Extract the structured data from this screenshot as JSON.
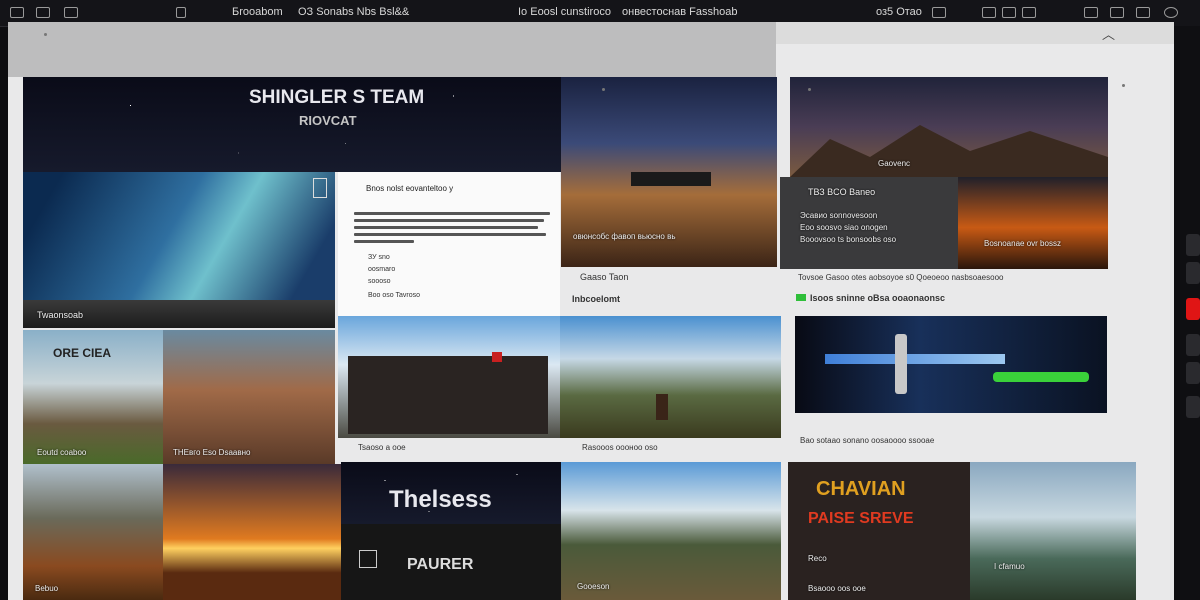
{
  "topbar": {
    "items": [
      "Бrooabom",
      "ОЗ Sonabs Nbs Bsl&&",
      "Io Eoosl cunstiroco",
      "онвестоснав Fasshoab",
      "оз5 Отао"
    ],
    "accent": "#141418"
  },
  "tiles": {
    "team_title": "SHINGLER S TEAM",
    "team_subtitle": "RIOVCAT",
    "aurora_caption": "Twaonsoab",
    "text_card_heading": "Bnos nolst eovanteltoo y",
    "text_card_bullets": [
      "ЗУ sno",
      "oosmaro",
      "soooso"
    ],
    "text_card_footer": "Boo oso Tavroso",
    "space_platform_caption": "овюнсобс фавоп вьюсно вь",
    "under_space_caption": "Gaaso Taon",
    "side_heading": "Inbcoelomt",
    "mountain_peak_caption": "Gaovenc",
    "dark_panel_heading": "ТВЗ BCO Baneo",
    "dark_panel_lines": [
      "Эсавио sonnovesoon",
      "Eoo soosvo siao onogen",
      "Booovsoo ts bonsoobs oso"
    ],
    "sunset_caption": "Bosnoanae ovr bossz",
    "long_caption": "Tovsoe Gasoo otes aobsoyoe s0 Qoeoeoo nasbsoaesooo",
    "green_heading": "Isoos sninne oBsa ooaonaonsc",
    "gadget_caption": "Bao sotaao sonano oosaoooo ssooae",
    "mountain_left_title": "ORE CIEA",
    "mountain_left_caption": "Eoutd coaboo",
    "mountain_right_caption": "ТНЕвго Eso Dsaавно",
    "city_caption": "Tsaoso a ooe",
    "landscape_caption": "Rasooos оооноо oso",
    "thebess_title": "Thelsess",
    "pauer_label": "PAURER",
    "chavian_title": "CHAVIAN",
    "chavian_subtitle": "PAISE SREVE",
    "chavian_badge": "Reco",
    "bottom_left_caption": "Bebuo",
    "bottom_road_caption": "Gooeson",
    "bottom_chavian_caption": "Bsaooo oos ooe",
    "bottom_right_caption": "I cfamuo"
  }
}
